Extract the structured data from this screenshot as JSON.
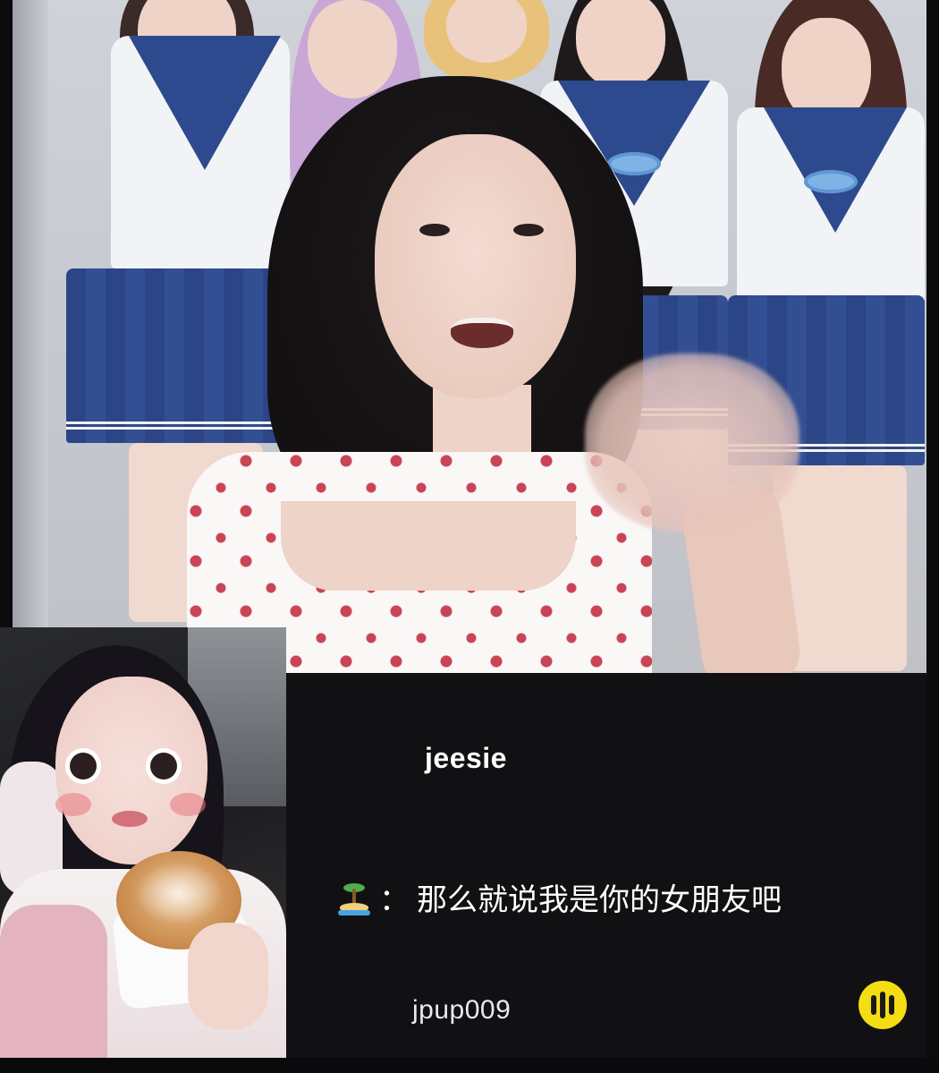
{
  "stream": {
    "host_name": "jeesie"
  },
  "chat": {
    "message": {
      "sender_icon": "desert-island-emoji",
      "separator": "：",
      "text": "那么就说我是你的女朋友吧"
    },
    "username": "jpup009"
  },
  "controls": {
    "voice_icon": "voice-wave-icon",
    "accent_color": "#f4de13"
  },
  "colors": {
    "background": "#0c0c0e",
    "chat_text": "#ffffff"
  }
}
